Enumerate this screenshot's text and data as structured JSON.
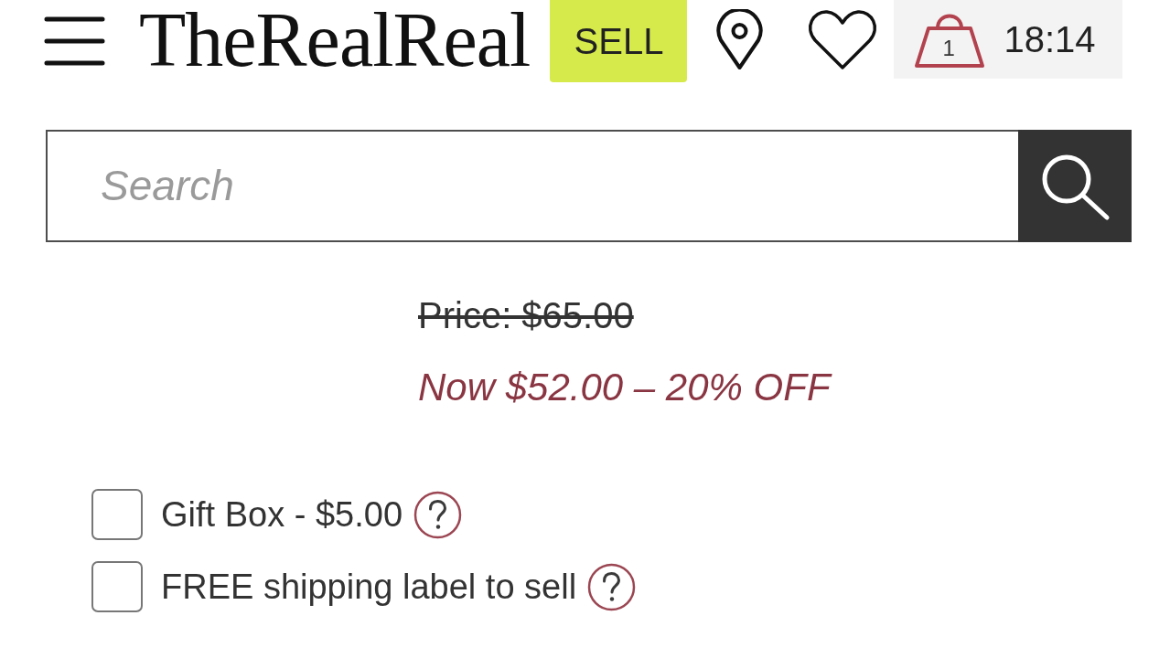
{
  "header": {
    "logo": "TheRealReal",
    "sell_button": "SELL",
    "cart_count": "1",
    "time": "18:14"
  },
  "search": {
    "placeholder": "Search"
  },
  "price": {
    "original": "Price: $65.00",
    "sale": "Now $52.00 – 20% OFF"
  },
  "options": [
    {
      "label": "Gift Box - $5.00",
      "checked": false
    },
    {
      "label": "FREE shipping label to sell",
      "checked": false
    }
  ]
}
